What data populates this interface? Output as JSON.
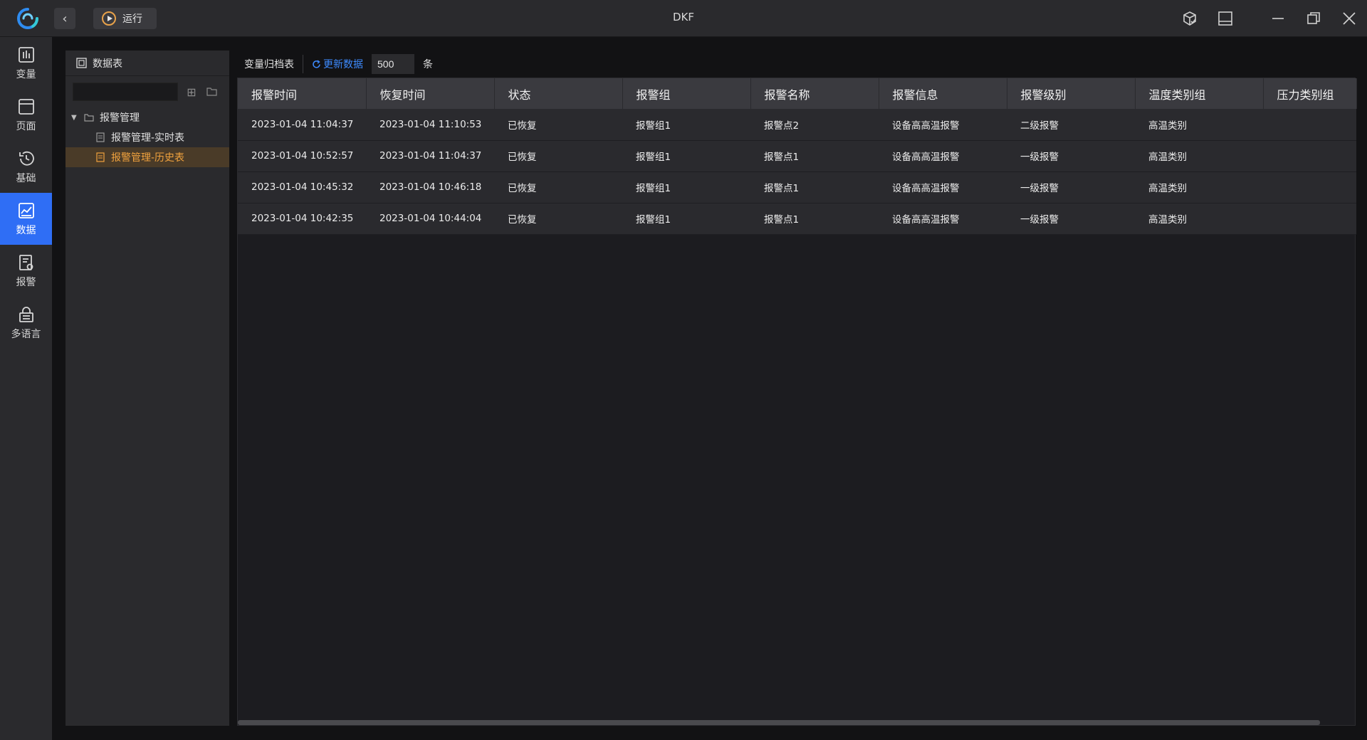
{
  "window": {
    "title": "DKF",
    "run_label": "运行"
  },
  "nav": [
    {
      "label": "变量",
      "icon": "chart-bars-icon"
    },
    {
      "label": "页面",
      "icon": "page-window-icon"
    },
    {
      "label": "基础",
      "icon": "clock-history-icon"
    },
    {
      "label": "数据",
      "icon": "data-chart-icon",
      "active": true
    },
    {
      "label": "报警",
      "icon": "alarm-doc-icon"
    },
    {
      "label": "多语言",
      "icon": "language-lock-icon"
    }
  ],
  "tree": {
    "header": "数据表",
    "search_value": "",
    "root_label": "报警管理",
    "children": [
      {
        "label": "报警管理-实时表",
        "selected": false
      },
      {
        "label": "报警管理-历史表",
        "selected": true
      }
    ]
  },
  "toolbar": {
    "title": "变量归档表",
    "refresh_label": "更新数据",
    "count_value": "500",
    "count_unit": "条"
  },
  "table": {
    "columns": [
      "报警时间",
      "恢复时间",
      "状态",
      "报警组",
      "报警名称",
      "报警信息",
      "报警级别",
      "温度类别组",
      "压力类别组"
    ],
    "rows": [
      [
        "2023-01-04 11:04:37",
        "2023-01-04 11:10:53",
        "已恢复",
        "报警组1",
        "报警点2",
        "设备高高温报警",
        "二级报警",
        "高温类别",
        ""
      ],
      [
        "2023-01-04 10:52:57",
        "2023-01-04 11:04:37",
        "已恢复",
        "报警组1",
        "报警点1",
        "设备高高温报警",
        "一级报警",
        "高温类别",
        ""
      ],
      [
        "2023-01-04 10:45:32",
        "2023-01-04 10:46:18",
        "已恢复",
        "报警组1",
        "报警点1",
        "设备高高温报警",
        "一级报警",
        "高温类别",
        ""
      ],
      [
        "2023-01-04 10:42:35",
        "2023-01-04 10:44:04",
        "已恢复",
        "报警组1",
        "报警点1",
        "设备高高温报警",
        "一级报警",
        "高温类别",
        ""
      ]
    ]
  },
  "colors": {
    "accent": "#2f6ef5",
    "selected_text": "#f0a23e",
    "link": "#3d8bff"
  }
}
